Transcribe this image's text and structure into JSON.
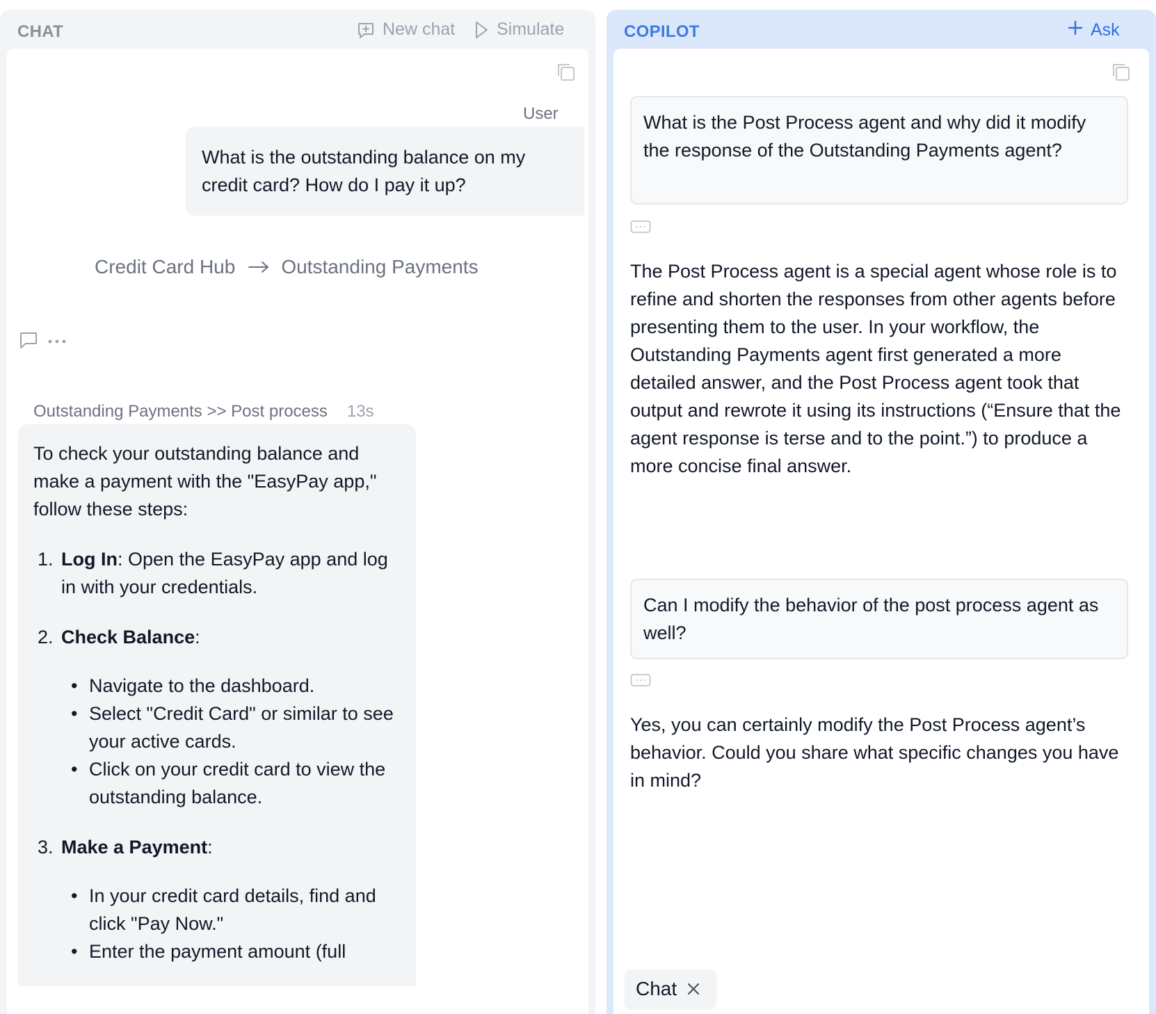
{
  "chat_panel": {
    "title": "CHAT",
    "new_chat_label": "New chat",
    "simulate_label": "Simulate",
    "user_label": "User",
    "user_message": "What is the outstanding balance on my credit card? How do I pay it up?",
    "route": {
      "from": "Credit Card Hub",
      "to": "Outstanding Payments"
    },
    "agent_meta": {
      "path": "Outstanding Payments >> Post process",
      "time": "13s"
    },
    "agent_message": {
      "intro": "To check your outstanding balance and make a payment with the \"EasyPay app,\" follow these steps:",
      "steps": [
        {
          "num": "1.",
          "title": "Log In",
          "text": ": Open the EasyPay app and log in with your credentials.",
          "bullets": []
        },
        {
          "num": "2.",
          "title": "Check Balance",
          "text": ":",
          "bullets": [
            "Navigate to the dashboard.",
            "Select \"Credit Card\" or similar to see your active cards.",
            "Click on your credit card to view the outstanding balance."
          ]
        },
        {
          "num": "3.",
          "title": "Make a Payment",
          "text": ":",
          "bullets": [
            "In your credit card details, find and click \"Pay Now.\"",
            "Enter the payment amount (full"
          ]
        }
      ]
    }
  },
  "copilot_panel": {
    "title": "COPILOT",
    "ask_label": "Ask",
    "question_1": "What is the Post Process agent and why did it modify the response of the Outstanding Payments agent?",
    "answer_1": "The Post Process agent is a special agent whose role is to refine and shorten the responses from other agents before presenting them to the user. In your workflow, the Outstanding Payments agent first generated a more detailed answer, and the Post Process agent took that output and rewrote it using its instructions (“Ensure that the agent response is terse and to the point.”) to produce a more concise final answer.",
    "question_2": "Can I modify the behavior of the post process agent as well?",
    "answer_2": "Yes, you can certainly modify the Post Process agent’s behavior. Could you share what specific changes you have in mind?",
    "context_chip": "Chat"
  },
  "colors": {
    "copilot_accent": "#2f6fe0",
    "copilot_header_bg": "#dbe8fb",
    "chat_header_bg": "#f3f4f6",
    "bubble_bg": "#f3f4f6"
  }
}
